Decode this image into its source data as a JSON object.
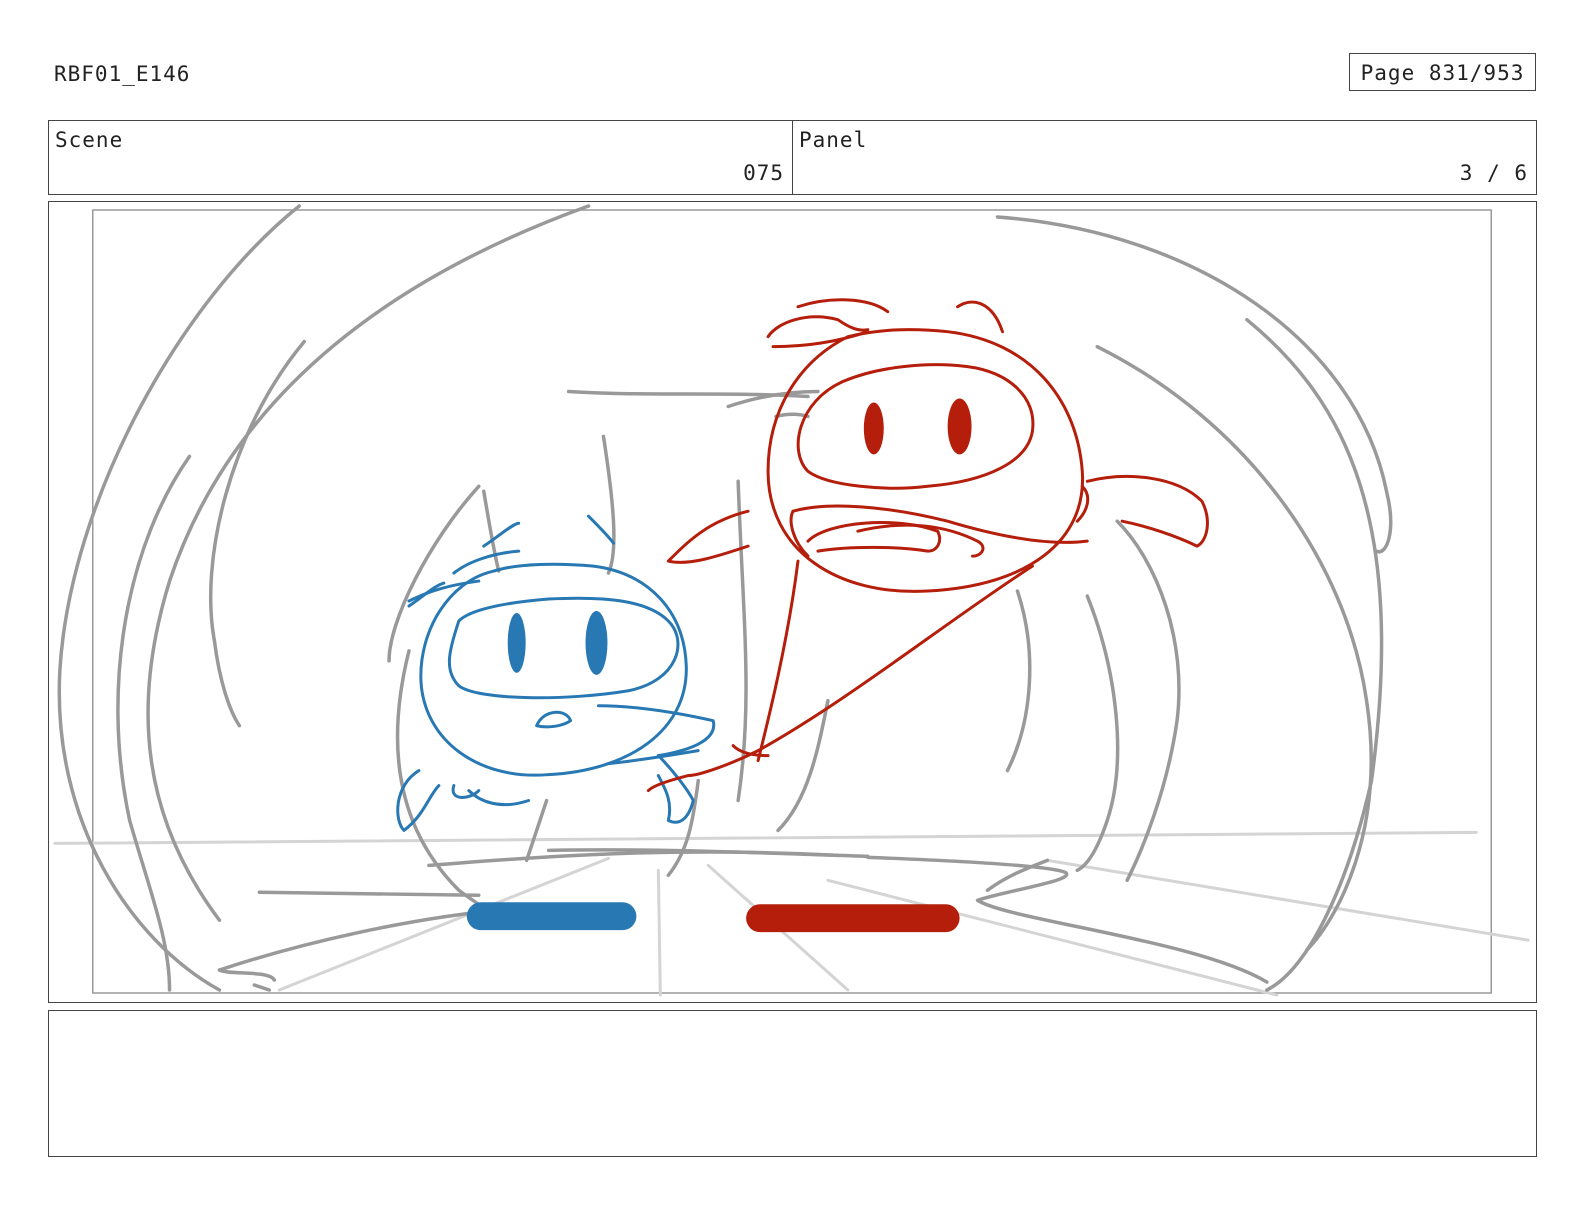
{
  "header": {
    "production_code": "RBF01_E146",
    "page_label": "Page 831/953"
  },
  "scene": {
    "label": "Scene",
    "value": "075"
  },
  "panel": {
    "label": "Panel",
    "value": "3 / 6"
  },
  "sketch": {
    "colors": {
      "blue_character": "#2878b4",
      "red_character": "#b41e0a",
      "background_lines": "#999999",
      "floor_lines": "#d4d4d4"
    }
  },
  "notes": {
    "text": ""
  }
}
